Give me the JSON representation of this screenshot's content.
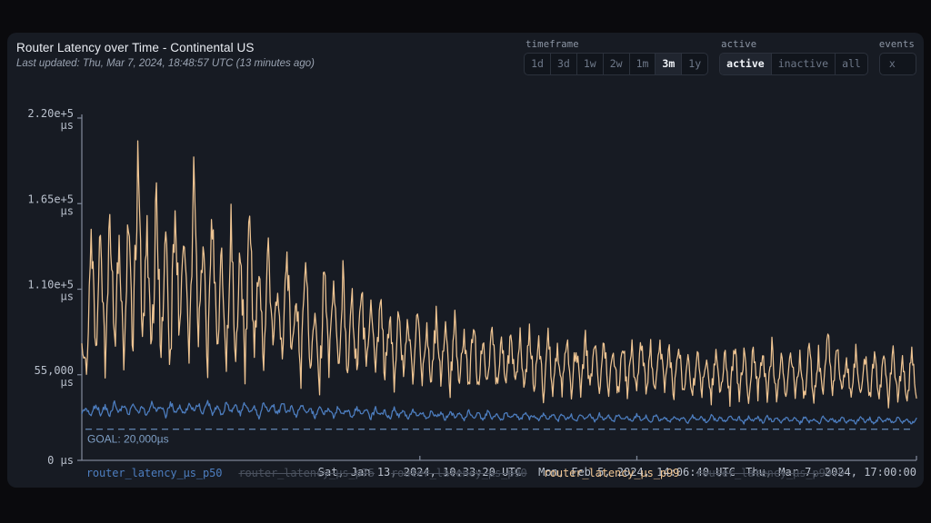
{
  "header": {
    "title": "Router Latency over Time - Continental US",
    "subtitle": "Last updated: Thu, Mar 7, 2024, 18:48:57 UTC (13 minutes ago)"
  },
  "controls": {
    "timeframe": {
      "label": "timeframe",
      "options": [
        "1d",
        "3d",
        "1w",
        "2w",
        "1m",
        "3m",
        "1y"
      ],
      "selected": "3m"
    },
    "active": {
      "label": "active",
      "options": [
        "active",
        "inactive",
        "all"
      ],
      "selected": "active"
    },
    "events": {
      "label": "events",
      "options": [
        "x"
      ],
      "selected": null
    }
  },
  "colors": {
    "background": "#0a0a0d",
    "panel": "#171b23",
    "p50": "#4d7ec0",
    "p99": "#eec492",
    "goal_line": "#5c7da8",
    "axis": "#7b8494",
    "tick_text": "#b9c0cc"
  },
  "annotation": {
    "goal_label": "GOAL: 20,000µs",
    "goal_value": 20000
  },
  "chart_data": {
    "type": "line",
    "title": "Router Latency over Time - Continental US",
    "xlabel": "",
    "ylabel": "",
    "units": "µs",
    "grid": false,
    "legend_position": "bottom",
    "ylim": [
      0,
      220000
    ],
    "ytick_values": [
      0,
      55000,
      110000,
      165000,
      220000
    ],
    "ytick_labels": [
      "0 µs",
      "55,000\nµs",
      "1.10e+5\nµs",
      "1.65e+5\nµs",
      "2.20e+5\nµs"
    ],
    "xlim": [
      "2023-12-07T17:00:00Z",
      "2024-03-07T17:00:00Z"
    ],
    "xtick_labels": [
      "Sat, Jan 13, 2024, 10:33:20 UTC",
      "Mon, Feb 5, 2024, 14:06:40 UTC",
      "Thu, Mar 7, 2024, 17:00:00"
    ],
    "xtick_fractions": [
      0.405,
      0.665,
      1.0
    ],
    "series": [
      {
        "name": "router_latency_µs_p50",
        "color": "#4d7ec0",
        "visible": true,
        "values": [
          30100,
          33800,
          29200,
          36400,
          30000,
          34900,
          28800,
          37200,
          31100,
          35600,
          29400,
          38100,
          30800,
          34200,
          28600,
          36900,
          31400,
          35100,
          29000,
          37600,
          30500,
          34700,
          28900,
          36200,
          31800,
          35900,
          29700,
          38400,
          30200,
          34400,
          28400,
          36600,
          31200,
          35300,
          29300,
          37100,
          30600,
          33900,
          28200,
          36000,
          31000,
          35500,
          29100,
          37800,
          30300,
          34100,
          28000,
          35800,
          30700,
          33600,
          27800,
          35200,
          30100,
          33100,
          27500,
          34600,
          29600,
          32700,
          27200,
          34000,
          29200,
          32300,
          27000,
          33500,
          28900,
          31900,
          26800,
          33000,
          28600,
          31500,
          26600,
          32600,
          28300,
          31100,
          26400,
          32200,
          28000,
          30800,
          26200,
          31800,
          27800,
          30500,
          26000,
          31400,
          27500,
          30200,
          25900,
          31000,
          27300,
          29900,
          25700,
          30700,
          27100,
          29600,
          25600,
          30400,
          26900,
          29400,
          25400,
          30100,
          26700,
          29200,
          25300,
          29900,
          26500,
          29000,
          25200,
          29700,
          26300,
          28800,
          25000,
          29500,
          26100,
          28600,
          24900,
          29300,
          26000,
          28400,
          24800,
          29100,
          25900,
          28200,
          24700,
          28900,
          25700,
          28100,
          24600,
          28700,
          25600,
          27900,
          24500,
          28500,
          25500,
          27800,
          24400,
          28400,
          25400,
          27600,
          24300,
          28200,
          25300,
          27500,
          24200,
          28100,
          25200,
          27400,
          24100,
          27900,
          25100,
          27300,
          24000,
          27800,
          25000,
          27200,
          23900,
          27700,
          24900,
          27100,
          23800,
          27600,
          24800,
          27000,
          23700,
          27500,
          24700,
          26900,
          23600,
          27400,
          24600,
          26800,
          23500,
          27300,
          24500,
          26700,
          23400,
          27200,
          24400,
          26600,
          23300,
          27100
        ],
        "approx_range": [
          23000,
          39000
        ]
      },
      {
        "name": "router_latency_µs_p75",
        "color": "#4a515e",
        "visible": false,
        "values": []
      },
      {
        "name": "router_latency_µs_p90",
        "color": "#4a515e",
        "visible": false,
        "values": []
      },
      {
        "name": "router_latency_µs_p99",
        "color": "#eec492",
        "visible": true,
        "values": [
          72000,
          62000,
          155000,
          66000,
          148000,
          61000,
          162000,
          70000,
          145000,
          64000,
          158000,
          68000,
          193000,
          74000,
          150000,
          63000,
          168000,
          71000,
          140000,
          60000,
          172000,
          76000,
          152000,
          66000,
          178000,
          80000,
          143000,
          62000,
          160000,
          69000,
          133000,
          58000,
          149000,
          67000,
          138000,
          61000,
          155000,
          72000,
          126000,
          57000,
          142000,
          64000,
          119000,
          54000,
          137000,
          63000,
          108000,
          52000,
          129000,
          60000,
          101000,
          50000,
          123000,
          58000,
          112000,
          55000,
          118000,
          57000,
          106000,
          53000,
          110000,
          56000,
          99000,
          51000,
          104000,
          54000,
          95000,
          49000,
          100000,
          52000,
          92000,
          48000,
          97000,
          51000,
          89000,
          47000,
          94000,
          50000,
          86000,
          46000,
          91000,
          49000,
          84000,
          45000,
          88000,
          48000,
          82000,
          45000,
          86000,
          47000,
          80000,
          44000,
          84000,
          47000,
          79000,
          44000,
          82000,
          46000,
          77000,
          43000,
          81000,
          46000,
          76000,
          43000,
          80000,
          45000,
          75000,
          42000,
          79000,
          45000,
          74000,
          42000,
          78000,
          44000,
          73000,
          42000,
          77000,
          44000,
          72000,
          41000,
          76000,
          44000,
          72000,
          41000,
          76000,
          43000,
          71000,
          41000,
          75000,
          43000,
          71000,
          41000,
          75000,
          43000,
          70000,
          40000,
          74000,
          43000,
          70000,
          40000,
          74000,
          42000,
          69000,
          40000,
          73000,
          42000,
          69000,
          40000,
          73000,
          42000,
          68000,
          40000,
          72000,
          42000,
          68000,
          39000,
          72000,
          41000,
          68000,
          39000,
          88000,
          45000,
          71000,
          41000,
          67000,
          39000,
          71000,
          41000,
          67000,
          39000,
          70000,
          41000,
          67000,
          39000,
          70000,
          41000,
          66000,
          38000,
          70000,
          40000
        ],
        "approx_range": [
          38000,
          193000
        ]
      },
      {
        "name": "router_latency_µs_p99.9",
        "color": "#4a515e",
        "visible": false,
        "values": []
      }
    ]
  }
}
